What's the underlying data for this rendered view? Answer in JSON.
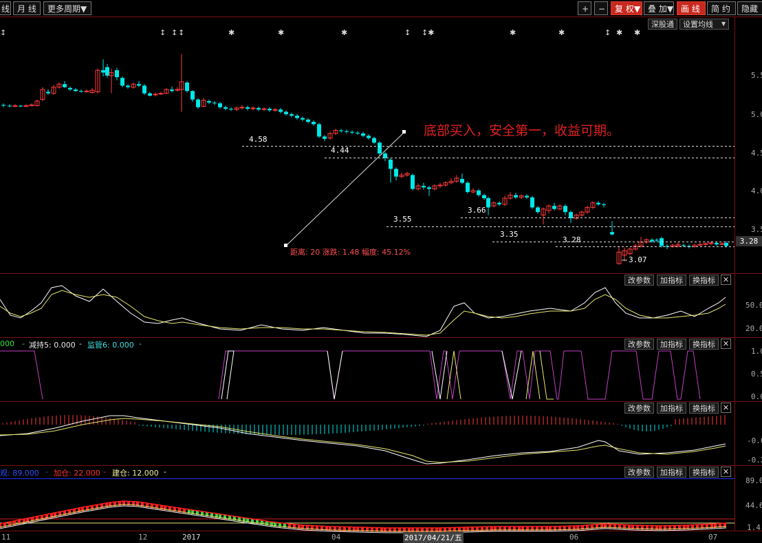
{
  "toolbar": {
    "line_partial": "线",
    "monthly": "月 线",
    "more_periods": "更多周期▼",
    "plus": "+",
    "minus": "−",
    "adjust": "复 权▼",
    "overlay": "叠 加▼",
    "line_mode": "画 线",
    "simple": "简 约",
    "hide": "隐藏"
  },
  "main_chart": {
    "shenguotong": "深股通",
    "ma_settings": "设置均线",
    "annotation": "底部买入，安全第一，收益可期。",
    "measure": "距离: 20 涨跌: 1.48 幅度: 45.12%",
    "current_price": "3.28",
    "y_ticks": [
      "5.5",
      "5.0",
      "4.5",
      "4.0",
      "3.5"
    ],
    "levels": [
      "4.58",
      "4.44",
      "3.66",
      "3.55",
      "3.35",
      "3.28",
      "3.07"
    ]
  },
  "events": [
    "↕",
    "↕",
    "↕",
    "↕",
    "✱",
    "✱",
    "✱",
    "↕",
    "↕✱",
    "✱",
    "✱",
    "↕",
    "✱",
    "✱"
  ],
  "panel_buttons": {
    "edit": "改参数",
    "add": "加指标",
    "swap": "换指标",
    "close": "✕"
  },
  "panel1": {
    "y_ticks": [
      "50.0",
      "20.0"
    ]
  },
  "panel2": {
    "legend_a": "000",
    "legend_b": "减持5: 0.000",
    "legend_c": "监管6: 0.000",
    "y_ticks": [
      "1.0",
      "0.5",
      "0.0"
    ]
  },
  "panel3": {
    "y_ticks": [
      "-0.0",
      "-0.2"
    ]
  },
  "panel4": {
    "legend_a": "观: 89.000",
    "legend_b": "加仓: 22.000",
    "legend_c": "建仓: 12.000",
    "y_ticks": [
      "89.0",
      "44.6",
      "1.4"
    ]
  },
  "x_axis": {
    "labels": [
      "11",
      "12",
      "2017",
      "04",
      "06",
      "07"
    ],
    "cursor_date": "2017/04/21/五"
  },
  "colors": {
    "up": "#ff3c3c",
    "down": "#00e8e8",
    "annot": "#e02020",
    "magenta": "#c040c0",
    "yellow": "#e8e870"
  }
}
